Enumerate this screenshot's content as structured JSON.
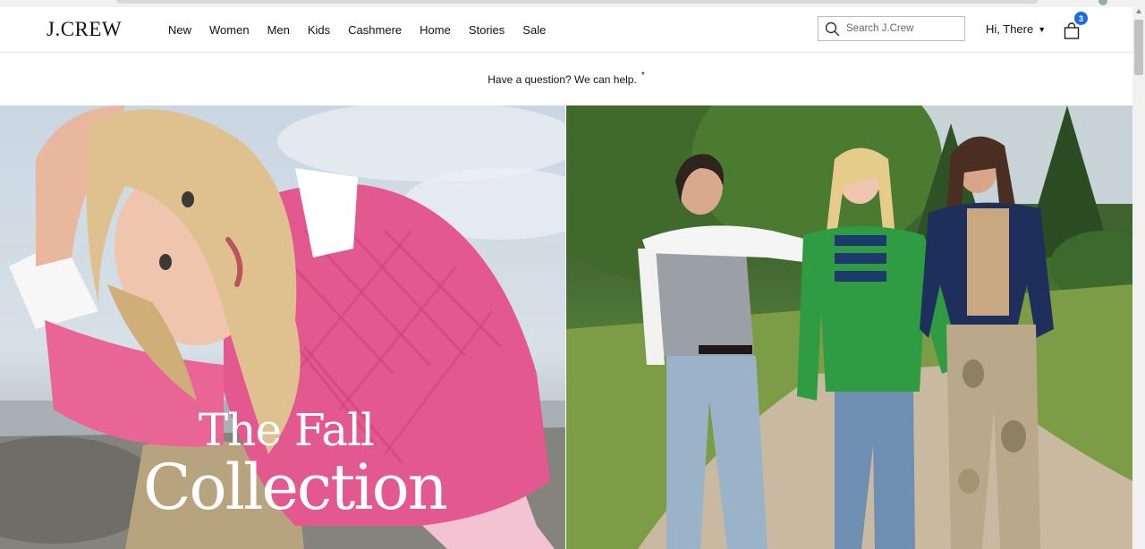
{
  "header": {
    "logo": "J.CREW",
    "nav": [
      "New",
      "Women",
      "Men",
      "Kids",
      "Cashmere",
      "Home",
      "Stories",
      "Sale"
    ],
    "search_placeholder": "Search J.Crew",
    "account_label": "Hi, There",
    "bag_count": "3"
  },
  "promo": {
    "text": "Have a question? We can help.",
    "star": "*"
  },
  "hero": {
    "title_line1": "The Fall",
    "title_line2": "Collection"
  },
  "colors": {
    "accent": "#1d6ae5",
    "left_sweater": "#e2588f",
    "right_green": "#2f9b43"
  }
}
